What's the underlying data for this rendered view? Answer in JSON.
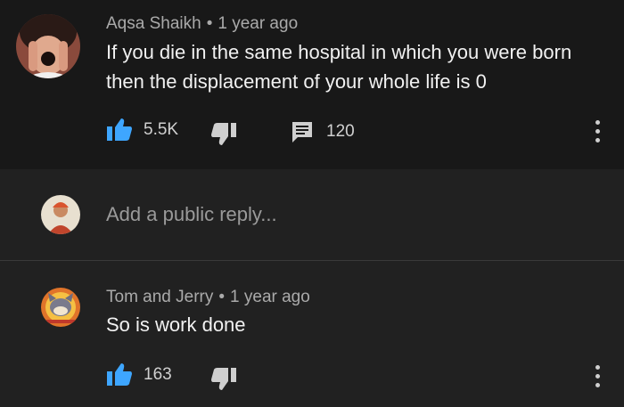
{
  "comments": [
    {
      "author": "Aqsa Shaikh",
      "separator": "•",
      "time": "1 year ago",
      "text_line1": "If you die in the same hospital in which you were born",
      "text_line2": "then the displacement of your whole life is 0",
      "likes": "5.5K",
      "replies": "120"
    },
    {
      "author": "Tom and Jerry",
      "separator": "•",
      "time": "1 year ago",
      "text": "So is work done",
      "likes": "163"
    }
  ],
  "reply_box": {
    "placeholder": "Add a public reply..."
  },
  "colors": {
    "like_accent": "#3ea6ff",
    "icon_gray": "#cfcfcf",
    "background": "#181818",
    "panel": "#212121"
  },
  "icons": [
    "thumb-up-icon",
    "thumb-down-icon",
    "comment-icon",
    "more-vert-icon"
  ]
}
